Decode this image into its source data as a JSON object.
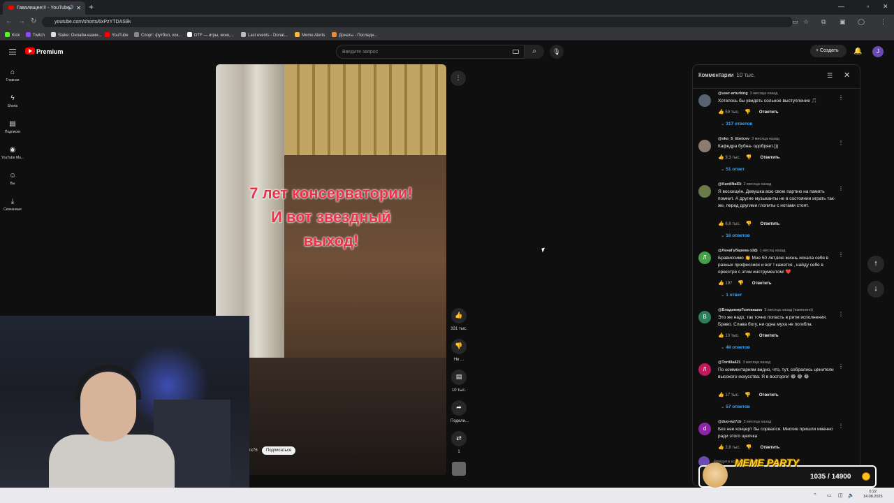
{
  "browser": {
    "tab_title": "Гавалищее!!! - YouTube",
    "url": "youtube.com/shorts/6xPzYTDAS9k",
    "bookmarks": [
      "Kick",
      "Twitch",
      "Stake: Онлайн-казин...",
      "YouTube",
      "Спорт: футбол, хок...",
      "DTF — игры, кино,...",
      "Last events - Donat...",
      "Meme Alerts",
      "Донаты - Последн..."
    ]
  },
  "header": {
    "logo_text": "Premium",
    "search_placeholder": "Введите запрос",
    "create_label": "Создать",
    "avatar_letter": "J"
  },
  "sidebar": {
    "items": [
      {
        "label": "Главная",
        "icon": "home-icon"
      },
      {
        "label": "Shorts",
        "icon": "shorts-icon"
      },
      {
        "label": "Подписки",
        "icon": "subscriptions-icon"
      },
      {
        "label": "YouTube Mu...",
        "icon": "youtube-music-icon"
      },
      {
        "label": "Вы",
        "icon": "you-icon"
      },
      {
        "label": "Скачанные",
        "icon": "downloads-icon"
      }
    ]
  },
  "video": {
    "caption": [
      "7 лет консерватории!",
      "И вот звездный",
      "выход!"
    ],
    "channel_suffix": "rx76",
    "subscribe_label": "Подписаться"
  },
  "actions": {
    "likes": "331 тыс.",
    "dislike": "Не ...",
    "comments": "10 тыс.",
    "share": "Подели...",
    "remix": "1"
  },
  "comments_panel": {
    "title": "Комментарии",
    "count": "10 тыс.",
    "reply_label": "Ответить",
    "add_placeholder": "Введите комментарий",
    "items": [
      {
        "author": "@user-arturking",
        "time": "3 месяца назад",
        "text": "Хотелось бы увидеть сольное выступление 🎵",
        "likes": "59 тыс.",
        "replies": "317 ответов",
        "avatar": "",
        "color": "#5a6270"
      },
      {
        "author": "@oko_5_tibetcev",
        "time": "3 месяца назад",
        "text": "Кафедра бубна- одобряет.)))",
        "likes": "9,3 тыс.",
        "replies": "51 ответ",
        "avatar": "",
        "color": "#8a7c70"
      },
      {
        "author": "@KardiNalDi",
        "time": "2 месяца назад",
        "text": "Я восхищён. Девушка всю свою партию на память помнит. А другие музыканты не в состоянии играть так-же, перед другими глопиты с нотами стоят.",
        "likes": "6,8 тыс.",
        "replies": "16 ответов",
        "avatar": "",
        "color": "#6b7a4a"
      },
      {
        "author": "@ЛенаГубарева-э3ф",
        "time": "1 месяц назад",
        "text": "Брависсимо 👏 Мне 50 лет,всю жизнь искала себя в разных профессиях и вот ! кажется , найду себя в оркестре с этим инструментом! ❤️",
        "likes": "197",
        "replies": "1 ответ",
        "avatar": "Л",
        "color": "#43a047"
      },
      {
        "author": "@ВладимирГоловашко",
        "time": "3 месяца назад (изменено)",
        "text": "Это же надо, так точно попасть в ритм исполнения. Браво. Слава богу, ни одна муха не погибла.",
        "likes": "10 тыс.",
        "replies": "48 ответов",
        "avatar": "В",
        "color": "#2e7d5b"
      },
      {
        "author": "@Tortilla421",
        "time": "3 месяца назад",
        "text": "По комментариям видно, что, тут, собрались ценители высокого искусства. Я в восторге! 😂 😂 😂",
        "likes": "17 тыс.",
        "replies": "57 ответов",
        "avatar": "Л",
        "color": "#c2185b"
      },
      {
        "author": "@duo-wz7zb",
        "time": "3 месяца назад",
        "text": "Без нее концерт бы сорвался. Многие пришли именно ради этого щелчка",
        "likes": "2,8 тыс.",
        "replies": "",
        "avatar": "d",
        "color": "#8e24aa"
      }
    ]
  },
  "overlay": {
    "meme_title": "MEME PARTY",
    "meme_count": "1035 / 14900"
  },
  "taskbar": {
    "time": "0:22",
    "date": "14.08.2025"
  }
}
